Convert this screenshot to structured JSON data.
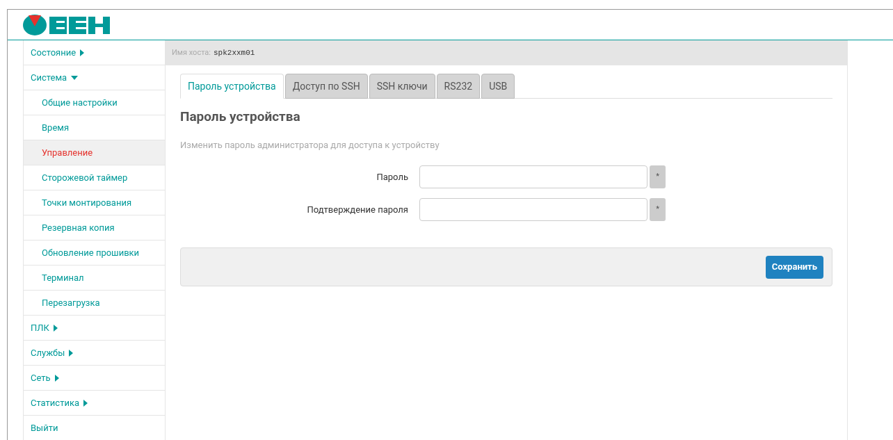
{
  "host": {
    "label": "Имя хоста:",
    "value": "spk2xxm01"
  },
  "sidebar": [
    {
      "label": "Состояние",
      "expanded": false
    },
    {
      "label": "Система",
      "expanded": true,
      "children": [
        {
          "label": "Общие настройки",
          "selected": false
        },
        {
          "label": "Время",
          "selected": false
        },
        {
          "label": "Управление",
          "selected": true
        },
        {
          "label": "Сторожевой таймер",
          "selected": false
        },
        {
          "label": "Точки монтирования",
          "selected": false
        },
        {
          "label": "Резервная копия",
          "selected": false
        },
        {
          "label": "Обновление прошивки",
          "selected": false
        },
        {
          "label": "Терминал",
          "selected": false
        },
        {
          "label": "Перезагрузка",
          "selected": false
        }
      ]
    },
    {
      "label": "ПЛК",
      "expanded": false
    },
    {
      "label": "Службы",
      "expanded": false
    },
    {
      "label": "Сеть",
      "expanded": false
    },
    {
      "label": "Статистика",
      "expanded": false
    },
    {
      "label": "Выйти",
      "kind": "link"
    }
  ],
  "tabs": [
    {
      "label": "Пароль устройства",
      "selected": true
    },
    {
      "label": "Доступ по SSH",
      "selected": false
    },
    {
      "label": "SSH ключи",
      "selected": false
    },
    {
      "label": "RS232",
      "selected": false
    },
    {
      "label": "USB",
      "selected": false
    }
  ],
  "heading": "Пароль устройства",
  "description": "Изменить пароль администратора для доступа к устройству",
  "fields": [
    {
      "label": "Пароль",
      "addon": "*"
    },
    {
      "label": "Подтверждение пароля",
      "addon": "*"
    }
  ],
  "save_button": "Сохранить"
}
